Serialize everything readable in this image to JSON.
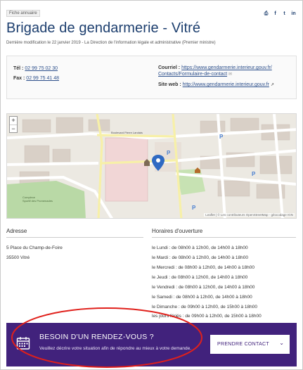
{
  "header": {
    "tag": "Fiche annuaire",
    "title": "Brigade de gendarmerie - Vitré",
    "modified": "Dernière modification le 22 janvier 2019 - La Direction de l'information légale et administrative (Premier ministre)",
    "share_icons": [
      "print-icon",
      "facebook-icon",
      "twitter-icon",
      "linkedin-icon"
    ]
  },
  "contact": {
    "tel_label": "Tél :",
    "tel_value": "02 99 75 02 30",
    "fax_label": "Fax :",
    "fax_value": "02 99 75 41 48",
    "mail_label": "Courriel :",
    "mail_value_1": "https://www.gendarmerie.interieur.gouv.fr/",
    "mail_value_2": "Contacts/Formulaire-de-contact",
    "web_label": "Site web :",
    "web_value": "http://www.gendarmerie.interieur.gouv.fr"
  },
  "map": {
    "zoom_in": "+",
    "zoom_out": "−",
    "attribution": "Leaflet | © Les contributeurs OpenStreetMap - géocodage IGN",
    "labels": [
      "Boulevard Pierre Landais",
      "Complexe Sportif des Promenades"
    ]
  },
  "address": {
    "heading": "Adresse",
    "line1": "5 Place du Champ-de-Foire",
    "line2": "35500 Vitré"
  },
  "hours": {
    "heading": "Horaires d'ouverture",
    "lines": [
      "le Lundi : de 08h00 à 12h00, de 14h00 à 18h00",
      "le Mardi : de 08h00 à 12h00, de 14h00 à 18h00",
      "le Mercredi : de 08h00 à 12h00, de 14h00 à 18h00",
      "le Jeudi : de 08h00 à 12h00, de 14h00 à 18h00",
      "le Vendredi : de 08h00 à 12h00, de 14h00 à 18h00",
      "le Samedi : de 08h00 à 12h00, de 14h00 à 18h00",
      "le Dimanche : de 09h00 à 12h00, de 15h00 à 18h00",
      "les jours fériés : de 09h00 à 12h00, de 15h00 à 18h00"
    ]
  },
  "banner": {
    "title": "BESOIN D'UN RENDEZ-VOUS ?",
    "text": "Veuillez décrire votre situation afin de répondre au mieux à votre demande.",
    "button": "PRENDRE CONTACT",
    "button_icon": "chevron-down-icon",
    "icon": "calendar-icon",
    "color": "#41227c"
  },
  "colors": {
    "title": "#1c3e6e",
    "link": "#2c4f8b",
    "annotation": "#e0201b"
  }
}
